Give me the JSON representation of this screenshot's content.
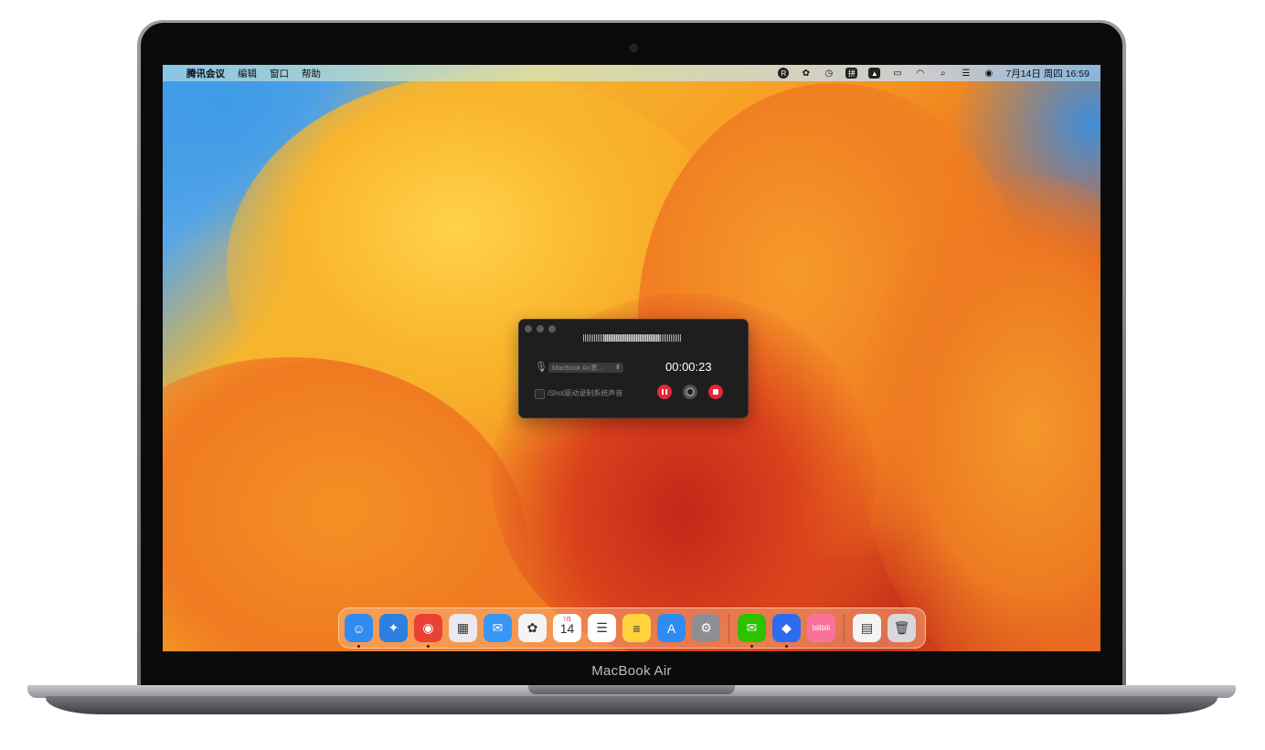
{
  "device": {
    "model_label": "MacBook Air"
  },
  "menubar": {
    "apple_glyph": "",
    "app_name": "腾讯会议",
    "menus": [
      "编辑",
      "窗口",
      "帮助"
    ],
    "status_icons": [
      {
        "name": "r-icon",
        "glyph": "R"
      },
      {
        "name": "wechat-status-icon",
        "glyph": "✿"
      },
      {
        "name": "time-machine-icon",
        "glyph": "◷"
      },
      {
        "name": "input-method-icon",
        "glyph": "拼"
      },
      {
        "name": "image-icon",
        "glyph": "▲"
      },
      {
        "name": "battery-icon",
        "glyph": "▭"
      },
      {
        "name": "wifi-icon",
        "glyph": "◠"
      },
      {
        "name": "search-icon",
        "glyph": "⌕"
      },
      {
        "name": "control-center-icon",
        "glyph": "☰"
      },
      {
        "name": "siri-icon",
        "glyph": "◉"
      }
    ],
    "datetime": "7月14日 周四 16:59"
  },
  "recorder": {
    "device_select": "MacBook Air麦...",
    "device_arrows": "⇕",
    "timer": "00:00:23",
    "checkbox_label": "iShot驱动录制系统声音",
    "mic_glyph": "🎙"
  },
  "dock": {
    "apps": [
      {
        "name": "finder",
        "glyph": "☺",
        "color": "#2f8cf0",
        "running": true
      },
      {
        "name": "safari",
        "glyph": "✦",
        "color": "#2d7fe0",
        "running": false
      },
      {
        "name": "chrome",
        "glyph": "◉",
        "color": "#e94235",
        "running": true
      },
      {
        "name": "launchpad",
        "glyph": "▦",
        "color": "#e9e9ef",
        "running": false
      },
      {
        "name": "mail",
        "glyph": "✉",
        "color": "#3796f5",
        "running": false
      },
      {
        "name": "photos",
        "glyph": "✿",
        "color": "#f4f4f4",
        "running": false
      },
      {
        "name": "calendar",
        "glyph": "14",
        "month": "7月",
        "color": "#ffffff",
        "running": false
      },
      {
        "name": "reminders",
        "glyph": "☰",
        "color": "#ffffff",
        "running": false
      },
      {
        "name": "notes",
        "glyph": "≡",
        "color": "#ffd23e",
        "running": false
      },
      {
        "name": "app-store",
        "glyph": "A",
        "color": "#2f8cf0",
        "running": false
      },
      {
        "name": "system-settings",
        "glyph": "⚙",
        "color": "#8e8e93",
        "running": false
      }
    ],
    "apps2": [
      {
        "name": "wechat",
        "glyph": "✉",
        "color": "#2dc100",
        "running": true
      },
      {
        "name": "tencent-meeting",
        "glyph": "◆",
        "color": "#2f6bf0",
        "running": true
      },
      {
        "name": "bilibili",
        "glyph": "bilibili",
        "color": "#fb7299",
        "running": false
      }
    ],
    "apps3": [
      {
        "name": "document-folder",
        "glyph": "▤",
        "color": "#f4f4f4",
        "running": false
      },
      {
        "name": "trash",
        "glyph": "🗑",
        "color": "#d8d8dc",
        "running": false
      }
    ]
  }
}
